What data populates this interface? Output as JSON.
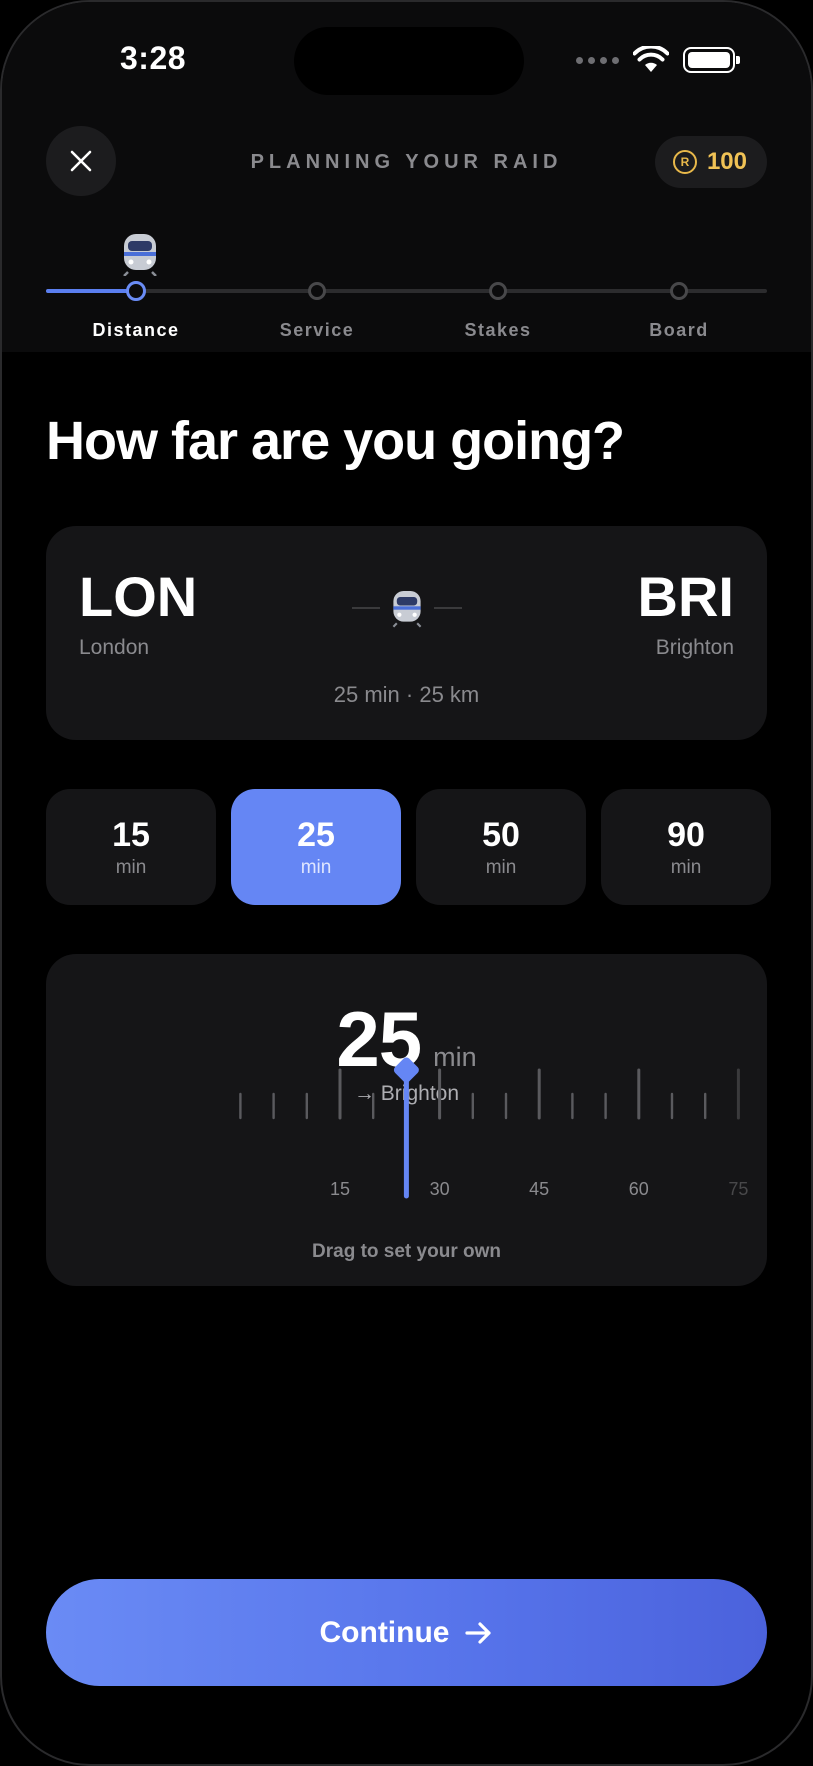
{
  "status": {
    "time": "3:28"
  },
  "header": {
    "title": "PLANNING YOUR RAID",
    "coin_symbol": "R",
    "coins": "100"
  },
  "steps": [
    {
      "label": "Distance",
      "active": true
    },
    {
      "label": "Service",
      "active": false
    },
    {
      "label": "Stakes",
      "active": false
    },
    {
      "label": "Board",
      "active": false
    }
  ],
  "question": "How far are you going?",
  "route": {
    "from_code": "LON",
    "from_city": "London",
    "to_code": "BRI",
    "to_city": "Brighton",
    "meta": "25 min · 25 km"
  },
  "presets": [
    {
      "value": "15",
      "unit": "min",
      "selected": false
    },
    {
      "value": "25",
      "unit": "min",
      "selected": true
    },
    {
      "value": "50",
      "unit": "min",
      "selected": false
    },
    {
      "value": "90",
      "unit": "min",
      "selected": false
    }
  ],
  "slider": {
    "value": "25",
    "unit": "min",
    "destination": "→ Brighton",
    "current": 25,
    "tick_labels": [
      "15",
      "30",
      "45",
      "60",
      "75"
    ],
    "hint": "Drag to set your own"
  },
  "continue": {
    "label": "Continue"
  },
  "colors": {
    "accent": "#6586f4",
    "coin": "#f0c255",
    "card": "#151517"
  }
}
